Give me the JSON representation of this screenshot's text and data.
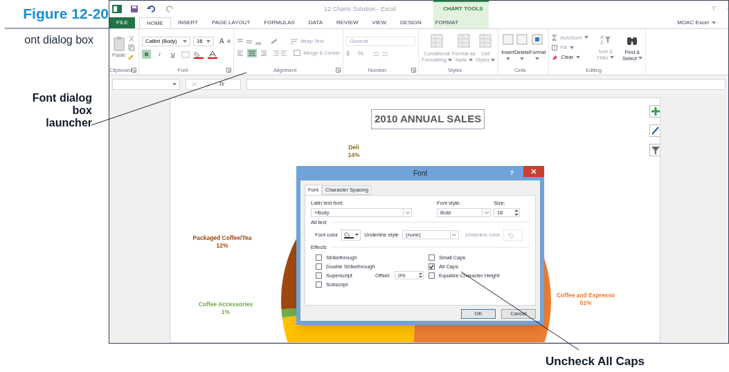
{
  "figure": {
    "number": "Figure 12-20",
    "caption": "ont dialog box"
  },
  "callouts": [
    {
      "text": "Font dialog box launcher"
    },
    {
      "text": "Uncheck All Caps"
    }
  ],
  "excel": {
    "title": "12 Charts Solution - Excel",
    "contextual_group": "CHART TOOLS",
    "account": "MOAC Excel",
    "help": "?",
    "tabs": [
      {
        "label": "FILE",
        "kind": "file",
        "selected": false
      },
      {
        "label": "HOME",
        "kind": "normal",
        "selected": true
      },
      {
        "label": "INSERT",
        "kind": "normal",
        "selected": false
      },
      {
        "label": "PAGE LAYOUT",
        "kind": "normal",
        "selected": false
      },
      {
        "label": "FORMULAS",
        "kind": "normal",
        "selected": false
      },
      {
        "label": "DATA",
        "kind": "normal",
        "selected": false
      },
      {
        "label": "REVIEW",
        "kind": "normal",
        "selected": false
      },
      {
        "label": "VIEW",
        "kind": "normal",
        "selected": false
      },
      {
        "label": "DESIGN",
        "kind": "contextual",
        "selected": false
      },
      {
        "label": "FORMAT",
        "kind": "contextual",
        "selected": false
      }
    ],
    "clipboard": {
      "paste": "Paste",
      "label": "Clipboard"
    },
    "font": {
      "name": "Calibri (Body)",
      "size": "16",
      "label": "Font",
      "grow": "A",
      "shrink": "A",
      "buttons": [
        {
          "label": "B",
          "selected": true
        },
        {
          "label": "I",
          "selected": false
        },
        {
          "label": "U",
          "selected": false
        }
      ]
    },
    "alignment": {
      "wrap": "Wrap Text",
      "merge": "Merge & Center",
      "label": "Alignment"
    },
    "number": {
      "format": "General",
      "currency": "$",
      "percent": "%",
      "label": "Number"
    },
    "styles": {
      "buttons": [
        [
          "Conditional",
          "Formatting"
        ],
        [
          "Format as",
          "Table"
        ],
        [
          "Cell",
          "Styles"
        ]
      ],
      "label": "Styles"
    },
    "cells": {
      "buttons": [
        "Insert",
        "Delete",
        "Format"
      ],
      "label": "Cells"
    },
    "editing": {
      "autosum": "AutoSum",
      "fill": "Fill",
      "clear": "Clear",
      "sort": [
        "Sort &",
        "Filter"
      ],
      "sort_letters": [
        "A",
        "Z"
      ],
      "find": [
        "Find &",
        "Select"
      ],
      "label": "Editing"
    },
    "formula_bar": {
      "fx": "fx"
    },
    "chart": {
      "title": "2010 ANNUAL SALES",
      "labels": [
        {
          "name": "Deli",
          "percent": "14%",
          "color": "#8c6d1f"
        },
        {
          "name": "Packaged Coffee/Tea",
          "percent": "12%",
          "color": "#9e480e"
        },
        {
          "name": "Coffee Accessories",
          "percent": "1%",
          "color": "#70ad47"
        },
        {
          "name": "Coffee and Espresso",
          "percent": "51%",
          "color": "#ed7d31"
        }
      ]
    }
  },
  "dialog": {
    "title": "Font",
    "help": "?",
    "tabs": [
      {
        "label": "Font",
        "selected": true
      },
      {
        "label": "Character Spacing",
        "selected": false
      }
    ],
    "latin_font": {
      "label": "Latin text font:",
      "value": "+Body"
    },
    "font_style": {
      "label": "Font style:",
      "value": "Bold"
    },
    "size": {
      "label": "Size:",
      "value": "16"
    },
    "all_text": "All text",
    "font_color": "Font color",
    "underline_style": {
      "label": "Underline style",
      "value": "(none)"
    },
    "underline_color": {
      "label": "Underline color",
      "disabled": true
    },
    "effects": "Effects",
    "effects_left": [
      {
        "label": "Strikethrough",
        "checked": false
      },
      {
        "label": "Double Strikethrough",
        "checked": false
      },
      {
        "label": "Superscript",
        "checked": false
      },
      {
        "label": "Subscript",
        "checked": false
      }
    ],
    "effects_right": [
      {
        "label": "Small Caps",
        "checked": false
      },
      {
        "label": "All Caps",
        "checked": true
      },
      {
        "label": "Equalize Character Height",
        "checked": false
      }
    ],
    "offset": {
      "label": "Offset:",
      "value": "0%"
    },
    "buttons": [
      "OK",
      "Cancel"
    ]
  }
}
